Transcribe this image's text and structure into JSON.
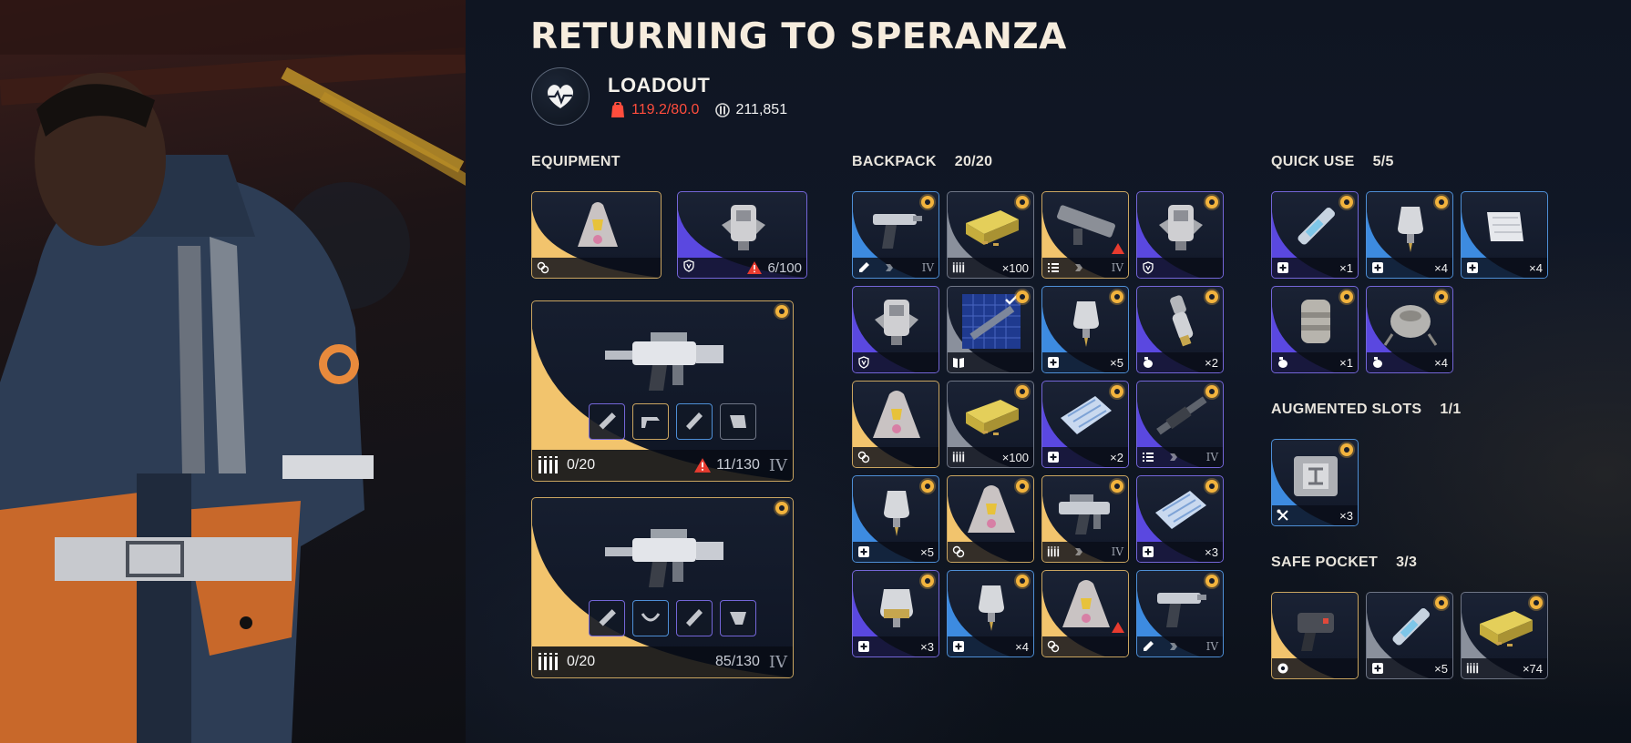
{
  "header": {
    "title": "RETURNING TO SPERANZA",
    "loadout_label": "LOADOUT",
    "weight": "119.2/80.0",
    "coins": "211,851"
  },
  "equipment": {
    "label": "EQUIPMENT",
    "augment": {
      "icon": "augment-icon",
      "rarity": "gold"
    },
    "shield": {
      "icon": "shield-icon",
      "rarity": "purple",
      "durability": "6/100",
      "warning": true
    },
    "weapon1": {
      "ammo": "0/20",
      "durability": "11/130",
      "tier": "IV",
      "warning": true
    },
    "weapon2": {
      "ammo": "0/20",
      "durability": "85/130",
      "tier": "IV",
      "warning": false
    }
  },
  "backpack": {
    "label": "BACKPACK",
    "count": "20/20",
    "items": [
      {
        "name": "pistol",
        "rarity": "blue",
        "qty": "",
        "tier": "IV",
        "foot": "attach-icon",
        "pin": true
      },
      {
        "name": "ammo-box",
        "rarity": "grey",
        "qty": "×100",
        "foot": "ammo-icon",
        "pin": true
      },
      {
        "name": "launcher",
        "rarity": "gold",
        "qty": "",
        "tier": "IV",
        "foot": "list-icon",
        "warning": true
      },
      {
        "name": "shield-pack",
        "rarity": "purple",
        "qty": "",
        "foot": "shield-icon",
        "pin": true
      },
      {
        "name": "shield-pack",
        "rarity": "purple",
        "qty": "",
        "foot": "shield-icon"
      },
      {
        "name": "blueprint",
        "rarity": "grey",
        "qty": "",
        "foot": "book-icon",
        "pin": true
      },
      {
        "name": "injector",
        "rarity": "blue",
        "qty": "×5",
        "foot": "plus-icon",
        "pin": true
      },
      {
        "name": "grenade-canister",
        "rarity": "purple",
        "qty": "×2",
        "foot": "grenade-icon",
        "pin": true
      },
      {
        "name": "augment-pack",
        "rarity": "gold",
        "qty": "",
        "foot": "augment-icon"
      },
      {
        "name": "ammo-box",
        "rarity": "grey",
        "qty": "×100",
        "foot": "ammo-icon",
        "pin": true
      },
      {
        "name": "bandage",
        "rarity": "purple",
        "qty": "×2",
        "foot": "plus-icon",
        "pin": true
      },
      {
        "name": "rifle",
        "rarity": "purple",
        "qty": "",
        "tier": "IV",
        "foot": "list-icon",
        "pin": true
      },
      {
        "name": "injector",
        "rarity": "blue",
        "qty": "×5",
        "foot": "plus-icon",
        "pin": true
      },
      {
        "name": "augment-pack",
        "rarity": "gold",
        "qty": "",
        "foot": "augment-icon",
        "pin": true
      },
      {
        "name": "smg",
        "rarity": "gold",
        "qty": "",
        "tier": "IV",
        "foot": "ammo-icon",
        "pin": true
      },
      {
        "name": "bandage",
        "rarity": "purple",
        "qty": "×3",
        "foot": "plus-icon",
        "pin": true
      },
      {
        "name": "injector-large",
        "rarity": "purple",
        "qty": "×3",
        "foot": "plus-icon",
        "pin": true
      },
      {
        "name": "injector",
        "rarity": "blue",
        "qty": "×4",
        "foot": "plus-icon",
        "pin": true
      },
      {
        "name": "augment-pack",
        "rarity": "gold",
        "qty": "",
        "foot": "augment-icon",
        "warning": true
      },
      {
        "name": "pistol",
        "rarity": "blue",
        "qty": "",
        "tier": "IV",
        "foot": "attach-icon",
        "pin": true
      }
    ]
  },
  "quick_use": {
    "label": "QUICK USE",
    "count": "5/5",
    "items": [
      {
        "name": "syringe",
        "rarity": "purple",
        "qty": "×1",
        "foot": "plus-icon",
        "pin": true
      },
      {
        "name": "injector",
        "rarity": "blue",
        "qty": "×4",
        "foot": "plus-icon",
        "pin": true
      },
      {
        "name": "bandage-roll",
        "rarity": "blue",
        "qty": "×4",
        "foot": "plus-icon"
      },
      {
        "name": "canister",
        "rarity": "purple",
        "qty": "×1",
        "foot": "grenade-icon",
        "pin": true
      },
      {
        "name": "mine",
        "rarity": "purple",
        "qty": "×4",
        "foot": "grenade-icon",
        "pin": true
      }
    ]
  },
  "augmented_slots": {
    "label": "AUGMENTED SLOTS",
    "count": "1/1",
    "items": [
      {
        "name": "toolbox",
        "rarity": "blue",
        "qty": "×3",
        "foot": "tools-icon",
        "pin": true
      }
    ]
  },
  "safe_pocket": {
    "label": "SAFE POCKET",
    "count": "3/3",
    "items": [
      {
        "name": "device",
        "rarity": "gold",
        "qty": "",
        "foot": "gear-icon"
      },
      {
        "name": "syringe",
        "rarity": "grey",
        "qty": "×5",
        "foot": "plus-icon",
        "pin": true
      },
      {
        "name": "ammo-box",
        "rarity": "grey",
        "qty": "×74",
        "foot": "ammo-icon",
        "pin": true
      }
    ]
  },
  "colors": {
    "gold": "#caa560",
    "purple": "#7466d8",
    "blue": "#4e8fd6",
    "grey": "#6f7686",
    "warning": "#e83b2f",
    "overweight": "#ff4d3d"
  }
}
